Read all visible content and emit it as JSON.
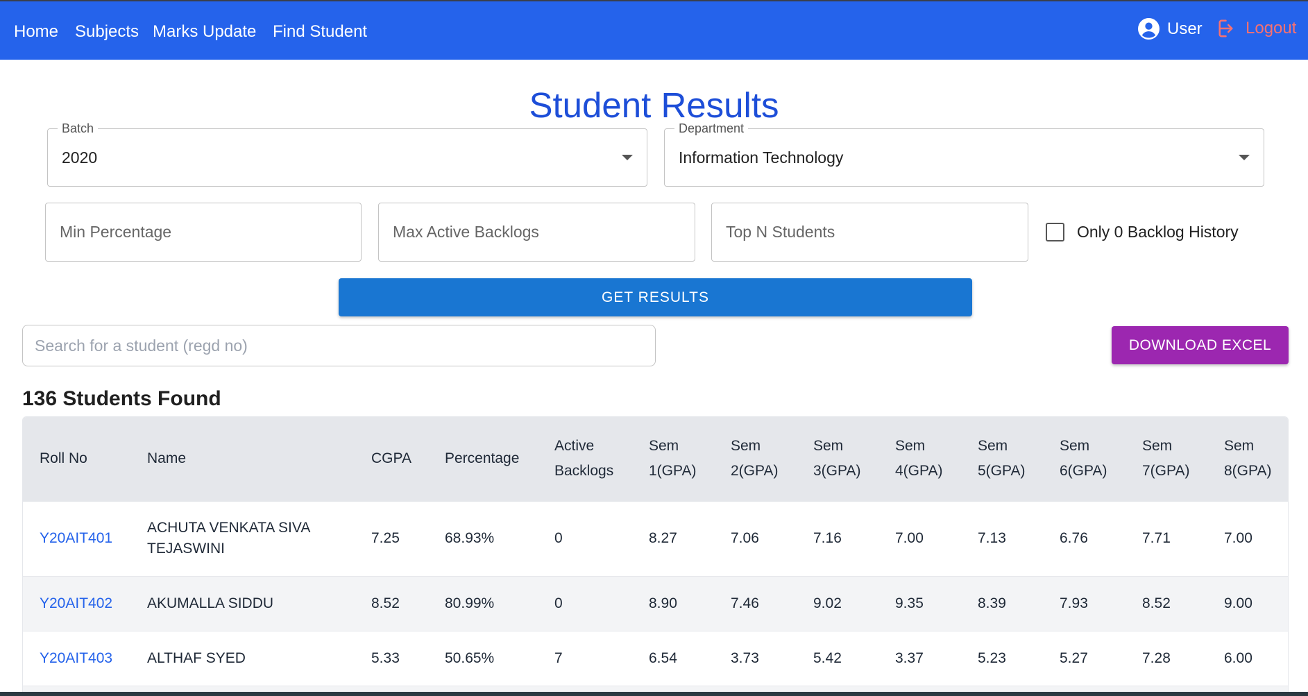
{
  "nav": {
    "links": [
      "Home",
      "Subjects",
      "Marks Update",
      "Find Student"
    ],
    "user_label": "User",
    "logout_label": "Logout"
  },
  "page": {
    "title": "Student Results"
  },
  "filters": {
    "batch": {
      "label": "Batch",
      "value": "2020"
    },
    "department": {
      "label": "Department",
      "value": "Information Technology"
    },
    "min_percentage_placeholder": "Min Percentage",
    "max_backlogs_placeholder": "Max Active Backlogs",
    "top_n_placeholder": "Top N Students",
    "zero_backlog_label": "Only 0 Backlog History",
    "zero_backlog_checked": false,
    "get_results_label": "GET RESULTS"
  },
  "search": {
    "placeholder": "Search for a student (regd no)"
  },
  "download_label": "DOWNLOAD EXCEL",
  "results": {
    "count_text": "136 Students Found",
    "columns": [
      "Roll No",
      "Name",
      "CGPA",
      "Percentage",
      "Active Backlogs",
      "Sem 1(GPA)",
      "Sem 2(GPA)",
      "Sem 3(GPA)",
      "Sem 4(GPA)",
      "Sem 5(GPA)",
      "Sem 6(GPA)",
      "Sem 7(GPA)",
      "Sem 8(GPA)"
    ],
    "rows": [
      [
        "Y20AIT401",
        "ACHUTA VENKATA SIVA TEJASWINI",
        "7.25",
        "68.93%",
        "0",
        "8.27",
        "7.06",
        "7.16",
        "7.00",
        "7.13",
        "6.76",
        "7.71",
        "7.00"
      ],
      [
        "Y20AIT402",
        "AKUMALLA SIDDU",
        "8.52",
        "80.99%",
        "0",
        "8.90",
        "7.46",
        "9.02",
        "9.35",
        "8.39",
        "7.93",
        "8.52",
        "9.00"
      ],
      [
        "Y20AIT403",
        "ALTHAF SYED",
        "5.33",
        "50.65%",
        "7",
        "6.54",
        "3.73",
        "5.42",
        "3.37",
        "5.23",
        "5.27",
        "7.28",
        "6.00"
      ]
    ]
  },
  "colors": {
    "navbar": "#2563eb",
    "title": "#1d4ed8",
    "primary_button": "#1976d2",
    "download_button": "#9c27b0",
    "link": "#2563eb",
    "logout": "#f87171"
  },
  "icons": {
    "user": "account-circle-icon",
    "logout": "logout-icon",
    "dropdown": "arrow-drop-down-icon"
  }
}
